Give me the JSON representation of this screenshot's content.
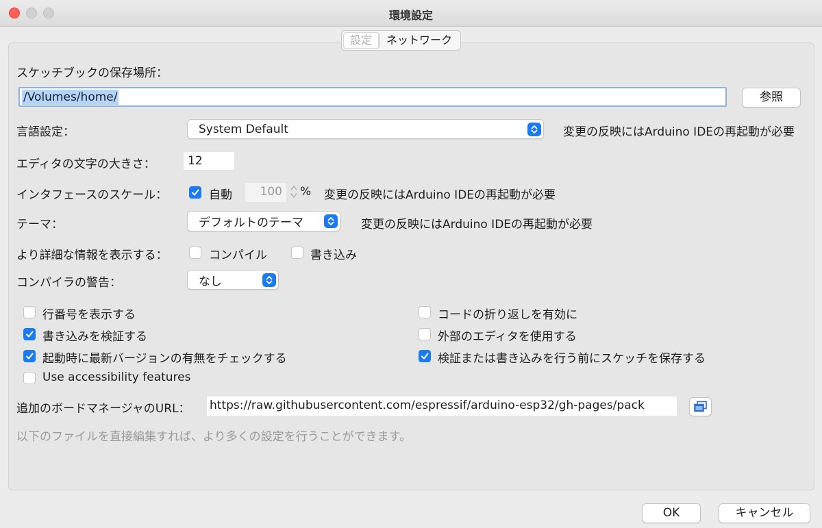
{
  "window": {
    "title": "環境設定"
  },
  "tabs": [
    {
      "label": "設定",
      "active": true
    },
    {
      "label": "ネットワーク",
      "active": false
    }
  ],
  "sketchbook": {
    "label": "スケッチブックの保存場所：",
    "path": "/Volumes/home/",
    "browse_label": "参照"
  },
  "language": {
    "label": "言語設定：",
    "value": "System Default",
    "note": "変更の反映にはArduino IDEの再起動が必要"
  },
  "font_size": {
    "label": "エディタの文字の大きさ：",
    "value": "12"
  },
  "scale": {
    "label": "インタフェースのスケール：",
    "auto_label": "自動",
    "auto_checked": true,
    "value": "100",
    "unit": "%",
    "note": "変更の反映にはArduino IDEの再起動が必要"
  },
  "theme": {
    "label": "テーマ：",
    "value": "デフォルトのテーマ",
    "note": "変更の反映にはArduino IDEの再起動が必要"
  },
  "verbose": {
    "label": "より詳細な情報を表示する：",
    "compile_label": "コンパイル",
    "compile_checked": false,
    "upload_label": "書き込み",
    "upload_checked": false
  },
  "warnings": {
    "label": "コンパイラの警告：",
    "value": "なし"
  },
  "options_left": [
    {
      "label": "行番号を表示する",
      "checked": false
    },
    {
      "label": "書き込みを検証する",
      "checked": true
    },
    {
      "label": "起動時に最新バージョンの有無をチェックする",
      "checked": true
    },
    {
      "label": "Use accessibility features",
      "checked": false
    }
  ],
  "options_right": [
    {
      "label": "コードの折り返しを有効に",
      "checked": false
    },
    {
      "label": "外部のエディタを使用する",
      "checked": false
    },
    {
      "label": "検証または書き込みを行う前にスケッチを保存する",
      "checked": true
    }
  ],
  "boards_url": {
    "label": "追加のボードマネージャのURL：",
    "value": "https://raw.githubusercontent.com/espressif/arduino-esp32/gh-pages/pack"
  },
  "more_prefs_note": "以下のファイルを直接編集すれば、より多くの設定を行うことができます。",
  "footer": {
    "ok_label": "OK",
    "cancel_label": "キャンセル"
  },
  "colors": {
    "accent": "#1a7bf2",
    "close": "#fe5f57"
  }
}
